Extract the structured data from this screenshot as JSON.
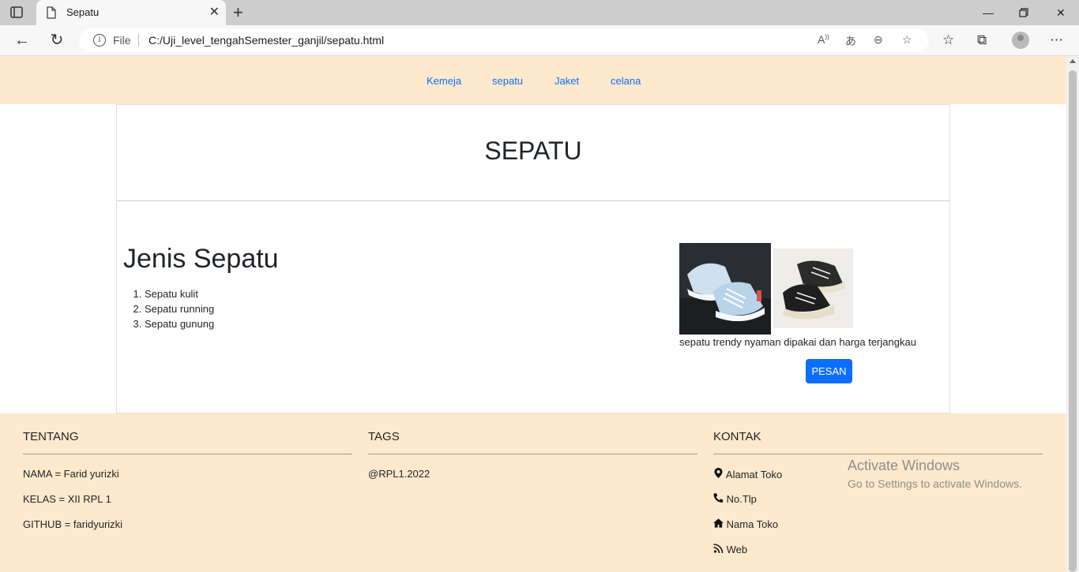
{
  "browser": {
    "tab_title": "Sepatu",
    "address_label": "File",
    "url": "C:/Uji_level_tengahSemester_ganjil/sepatu.html"
  },
  "nav": {
    "items": [
      {
        "label": "Kemeja"
      },
      {
        "label": "sepatu"
      },
      {
        "label": "Jaket"
      },
      {
        "label": "celana"
      }
    ],
    "link_color": "#0d6efd",
    "background": "#ffe9cc"
  },
  "header": {
    "title": "SEPATU"
  },
  "main": {
    "heading": "Jenis Sepatu",
    "list": [
      "Sepatu kulit",
      "Sepatu running",
      "Sepatu gunung"
    ],
    "description": "sepatu trendy nyaman dipakai dan harga terjangkau",
    "order_button": "PESAN",
    "button_color": "#0d6efd"
  },
  "footer": {
    "tentang": {
      "title": "TENTANG",
      "items": [
        "NAMA = Farid yurizki",
        "KELAS = XII RPL 1",
        "GITHUB = faridyurizki"
      ]
    },
    "tags": {
      "title": "TAGS",
      "items": [
        "@RPL1.2022"
      ]
    },
    "kontak": {
      "title": "KONTAK",
      "items": [
        {
          "icon": "map-marker-icon",
          "label": "Alamat Toko"
        },
        {
          "icon": "phone-icon",
          "label": "No.Tlp"
        },
        {
          "icon": "home-icon",
          "label": "Nama Toko"
        },
        {
          "icon": "rss-icon",
          "label": "Web"
        }
      ]
    }
  },
  "watermark": {
    "line1": "Activate Windows",
    "line2": "Go to Settings to activate Windows."
  }
}
